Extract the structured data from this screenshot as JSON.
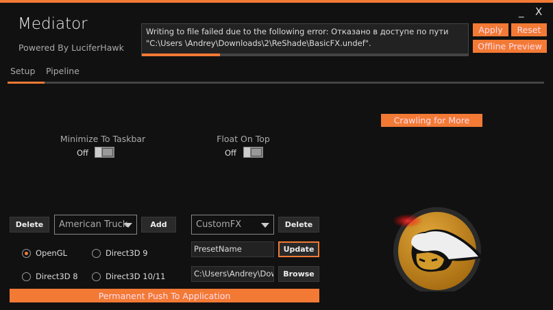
{
  "app": {
    "title": "Mediator",
    "subtitle": "Powered By LuciferHawk"
  },
  "window": {
    "minimize": "_",
    "close": "X"
  },
  "status": {
    "message": "Writing to file failed due to the following error: Отказано в доступе по пути \"C:\\Users \\Andrey\\Downloads\\2\\ReShade\\BasicFX.undef\".",
    "progress_percent": 24
  },
  "header_buttons": {
    "apply": "Apply",
    "reset": "Reset",
    "offline_preview": "Offline Preview"
  },
  "tabs": [
    {
      "label": "Setup",
      "active": true
    },
    {
      "label": "Pipeline",
      "active": false
    }
  ],
  "crawling": "Crawling for More",
  "options": {
    "minimize_to_taskbar": {
      "label": "Minimize To Taskbar",
      "state": "Off"
    },
    "float_on_top": {
      "label": "Float On Top",
      "state": "Off"
    }
  },
  "game": {
    "delete": "Delete",
    "selected": "American Truck",
    "add": "Add"
  },
  "preset": {
    "selected": "CustomFX",
    "delete": "Delete",
    "name_value": "PresetName",
    "update": "Update",
    "path_value": "C:\\Users\\Andrey\\Downloads",
    "browse": "Browse"
  },
  "api": [
    {
      "label": "OpenGL",
      "checked": true
    },
    {
      "label": "Direct3D 9",
      "checked": false
    },
    {
      "label": "Direct3D 8",
      "checked": false
    },
    {
      "label": "Direct3D 10/11",
      "checked": false
    }
  ],
  "push": "Permanent Push To Application",
  "colors": {
    "accent": "#f37a35",
    "background": "#111111"
  }
}
